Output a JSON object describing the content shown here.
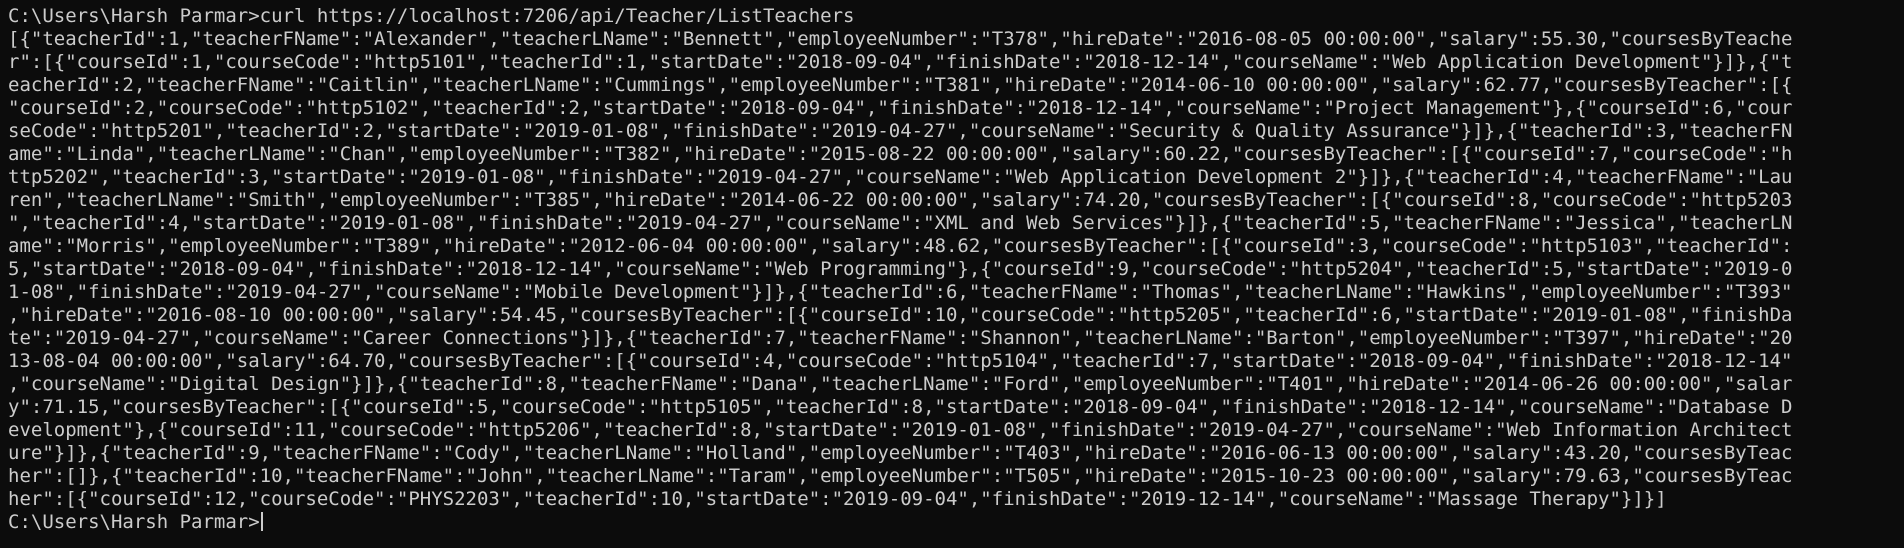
{
  "terminal": {
    "lines": [
      "C:\\Users\\Harsh Parmar>curl https://localhost:7206/api/Teacher/ListTeachers",
      "[{\"teacherId\":1,\"teacherFName\":\"Alexander\",\"teacherLName\":\"Bennett\",\"employeeNumber\":\"T378\",\"hireDate\":\"2016-08-05 00:00:00\",\"salary\":55.30,\"coursesByTeache",
      "r\":[{\"courseId\":1,\"courseCode\":\"http5101\",\"teacherId\":1,\"startDate\":\"2018-09-04\",\"finishDate\":\"2018-12-14\",\"courseName\":\"Web Application Development\"}]},{\"t",
      "eacherId\":2,\"teacherFName\":\"Caitlin\",\"teacherLName\":\"Cummings\",\"employeeNumber\":\"T381\",\"hireDate\":\"2014-06-10 00:00:00\",\"salary\":62.77,\"coursesByTeacher\":[{",
      "\"courseId\":2,\"courseCode\":\"http5102\",\"teacherId\":2,\"startDate\":\"2018-09-04\",\"finishDate\":\"2018-12-14\",\"courseName\":\"Project Management\"},{\"courseId\":6,\"cour",
      "seCode\":\"http5201\",\"teacherId\":2,\"startDate\":\"2019-01-08\",\"finishDate\":\"2019-04-27\",\"courseName\":\"Security & Quality Assurance\"}]},{\"teacherId\":3,\"teacherFN",
      "ame\":\"Linda\",\"teacherLName\":\"Chan\",\"employeeNumber\":\"T382\",\"hireDate\":\"2015-08-22 00:00:00\",\"salary\":60.22,\"coursesByTeacher\":[{\"courseId\":7,\"courseCode\":\"h",
      "ttp5202\",\"teacherId\":3,\"startDate\":\"2019-01-08\",\"finishDate\":\"2019-04-27\",\"courseName\":\"Web Application Development 2\"}]},{\"teacherId\":4,\"teacherFName\":\"Lau",
      "ren\",\"teacherLName\":\"Smith\",\"employeeNumber\":\"T385\",\"hireDate\":\"2014-06-22 00:00:00\",\"salary\":74.20,\"coursesByTeacher\":[{\"courseId\":8,\"courseCode\":\"http5203",
      "\",\"teacherId\":4,\"startDate\":\"2019-01-08\",\"finishDate\":\"2019-04-27\",\"courseName\":\"XML and Web Services\"}]},{\"teacherId\":5,\"teacherFName\":\"Jessica\",\"teacherLN",
      "ame\":\"Morris\",\"employeeNumber\":\"T389\",\"hireDate\":\"2012-06-04 00:00:00\",\"salary\":48.62,\"coursesByTeacher\":[{\"courseId\":3,\"courseCode\":\"http5103\",\"teacherId\":",
      "5,\"startDate\":\"2018-09-04\",\"finishDate\":\"2018-12-14\",\"courseName\":\"Web Programming\"},{\"courseId\":9,\"courseCode\":\"http5204\",\"teacherId\":5,\"startDate\":\"2019-0",
      "1-08\",\"finishDate\":\"2019-04-27\",\"courseName\":\"Mobile Development\"}]},{\"teacherId\":6,\"teacherFName\":\"Thomas\",\"teacherLName\":\"Hawkins\",\"employeeNumber\":\"T393\"",
      ",\"hireDate\":\"2016-08-10 00:00:00\",\"salary\":54.45,\"coursesByTeacher\":[{\"courseId\":10,\"courseCode\":\"http5205\",\"teacherId\":6,\"startDate\":\"2019-01-08\",\"finishDa",
      "te\":\"2019-04-27\",\"courseName\":\"Career Connections\"}]},{\"teacherId\":7,\"teacherFName\":\"Shannon\",\"teacherLName\":\"Barton\",\"employeeNumber\":\"T397\",\"hireDate\":\"20",
      "13-08-04 00:00:00\",\"salary\":64.70,\"coursesByTeacher\":[{\"courseId\":4,\"courseCode\":\"http5104\",\"teacherId\":7,\"startDate\":\"2018-09-04\",\"finishDate\":\"2018-12-14\"",
      ",\"courseName\":\"Digital Design\"}]},{\"teacherId\":8,\"teacherFName\":\"Dana\",\"teacherLName\":\"Ford\",\"employeeNumber\":\"T401\",\"hireDate\":\"2014-06-26 00:00:00\",\"salar",
      "y\":71.15,\"coursesByTeacher\":[{\"courseId\":5,\"courseCode\":\"http5105\",\"teacherId\":8,\"startDate\":\"2018-09-04\",\"finishDate\":\"2018-12-14\",\"courseName\":\"Database D",
      "evelopment\"},{\"courseId\":11,\"courseCode\":\"http5206\",\"teacherId\":8,\"startDate\":\"2019-01-08\",\"finishDate\":\"2019-04-27\",\"courseName\":\"Web Information Architect",
      "ure\"}]},{\"teacherId\":9,\"teacherFName\":\"Cody\",\"teacherLName\":\"Holland\",\"employeeNumber\":\"T403\",\"hireDate\":\"2016-06-13 00:00:00\",\"salary\":43.20,\"coursesByTeac",
      "her\":[]},{\"teacherId\":10,\"teacherFName\":\"John\",\"teacherLName\":\"Taram\",\"employeeNumber\":\"T505\",\"hireDate\":\"2015-10-23 00:00:00\",\"salary\":79.63,\"coursesByTeac",
      "her\":[{\"courseId\":12,\"courseCode\":\"PHYS2203\",\"teacherId\":10,\"startDate\":\"2019-09-04\",\"finishDate\":\"2019-12-14\",\"courseName\":\"Massage Therapy\"}]}]"
    ],
    "prompt": "C:\\Users\\Harsh Parmar>",
    "colors": {
      "background": "#0c0c0c",
      "foreground": "#cccccc"
    }
  }
}
